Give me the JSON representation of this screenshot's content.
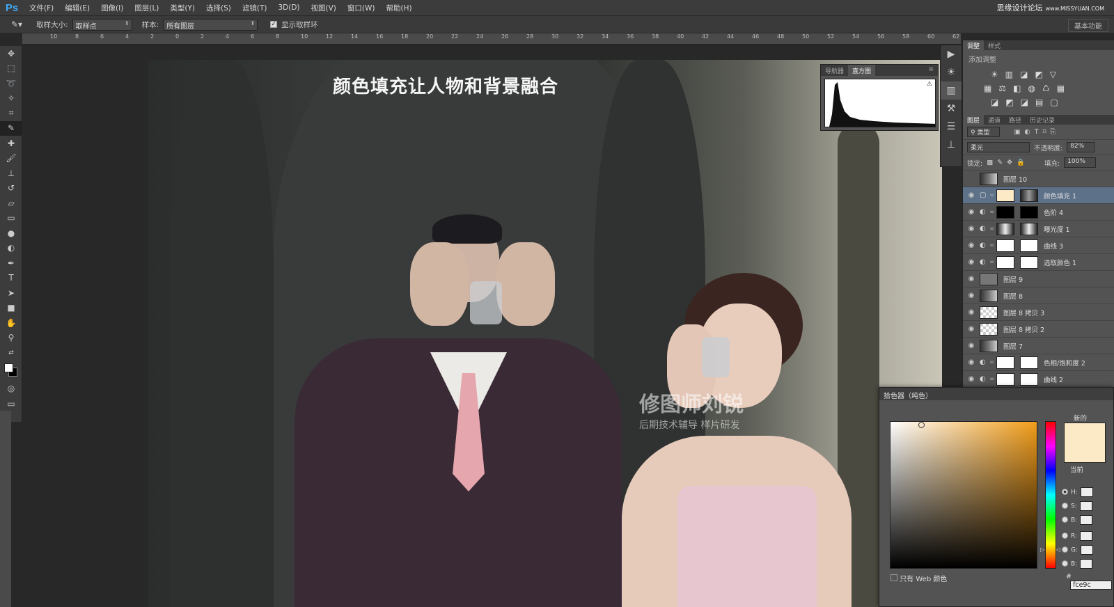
{
  "menubar": {
    "logo": "Ps",
    "items": [
      "文件(F)",
      "编辑(E)",
      "图像(I)",
      "图层(L)",
      "类型(Y)",
      "选择(S)",
      "滤镜(T)",
      "3D(D)",
      "视图(V)",
      "窗口(W)",
      "帮助(H)"
    ],
    "watermark": "思缘设计论坛",
    "watermark_url": "www.MISSYUAN.COM"
  },
  "options": {
    "sample_size_label": "取样大小:",
    "sample_size_value": "取样点",
    "sample_label": "样本:",
    "sample_value": "所有图层",
    "show_ring_label": "显示取样环",
    "workspace": "基本功能"
  },
  "ruler_h_ticks": [
    "10",
    "8",
    "6",
    "4",
    "2",
    "0",
    "2",
    "4",
    "6",
    "8",
    "10",
    "12",
    "14",
    "16",
    "18",
    "20",
    "22",
    "24",
    "26",
    "28",
    "30",
    "32",
    "34",
    "36",
    "38",
    "40",
    "42",
    "44",
    "46",
    "48",
    "50",
    "52",
    "54",
    "56",
    "58",
    "60",
    "62"
  ],
  "canvas": {
    "title": "颜色填充让人物和背景融合",
    "watermark_main": "修图师刘锐",
    "watermark_sub": "后期技术辅导 样片研发"
  },
  "histogram_panel": {
    "tabs": [
      "导航器",
      "直方图"
    ]
  },
  "right_panel": {
    "top_tabs": [
      "调整",
      "样式"
    ],
    "add_adjustment": "添加调整",
    "layer_tabs": [
      "图层",
      "通道",
      "路径",
      "历史记录"
    ],
    "filter_kind": "类型",
    "blend_mode": "柔光",
    "opacity_label": "不透明度:",
    "opacity_value": "82%",
    "lock_label": "锁定:",
    "fill_label": "填充:",
    "fill_value": "100%",
    "layers": [
      {
        "name": "图层 10",
        "visible": false,
        "selected": false,
        "kind": "photo"
      },
      {
        "name": "颜色填充 1",
        "visible": true,
        "selected": true,
        "kind": "fill"
      },
      {
        "name": "色阶 4",
        "visible": true,
        "selected": false,
        "kind": "adjust-dark"
      },
      {
        "name": "曝光度 1",
        "visible": true,
        "selected": false,
        "kind": "adjust-photo"
      },
      {
        "name": "曲线 3",
        "visible": true,
        "selected": false,
        "kind": "adjust"
      },
      {
        "name": "选取颜色 1",
        "visible": true,
        "selected": false,
        "kind": "adjust"
      },
      {
        "name": "图层 9",
        "visible": true,
        "selected": false,
        "kind": "gray"
      },
      {
        "name": "图层 8",
        "visible": true,
        "selected": false,
        "kind": "photo"
      },
      {
        "name": "图层 8 拷贝 3",
        "visible": true,
        "selected": false,
        "kind": "checker"
      },
      {
        "name": "图层 8 拷贝 2",
        "visible": true,
        "selected": false,
        "kind": "checker"
      },
      {
        "name": "图层 7",
        "visible": true,
        "selected": false,
        "kind": "photo"
      },
      {
        "name": "色相/饱和度 2",
        "visible": true,
        "selected": false,
        "kind": "adjust"
      },
      {
        "name": "曲线 2",
        "visible": true,
        "selected": false,
        "kind": "adjust"
      }
    ]
  },
  "color_picker": {
    "title": "拾色器（纯色）",
    "new_label": "新的",
    "current_label": "当前",
    "fields": [
      "H:",
      "S:",
      "B:",
      "R:",
      "G:",
      "B:"
    ],
    "web_only": "只有 Web 颜色",
    "hex_label": "#",
    "hex_value": "fce9c",
    "selected_color": "#fce9c6"
  }
}
